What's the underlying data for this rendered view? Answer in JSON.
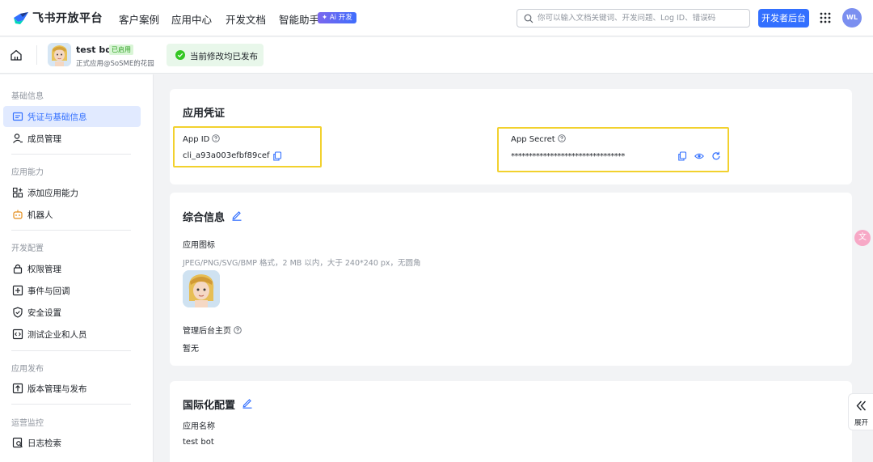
{
  "nav": {
    "brand": "飞书开放平台",
    "links": [
      "客户案例",
      "应用中心",
      "开发文档",
      "智能助手"
    ],
    "ai_badge": "✦ Ai 开发",
    "search_placeholder": "你可以输入文档关键词、开发问题、Log ID、错误码",
    "dev_button": "开发者后台",
    "avatar_initials": "WL"
  },
  "subheader": {
    "app_name": "test bot",
    "app_status_tag": "已启用",
    "app_subtitle": "正式应用@SoSME的花园",
    "status_message": "当前修改均已发布"
  },
  "sidebar": {
    "sections": [
      {
        "title": "基础信息",
        "items": [
          {
            "label": "凭证与基础信息",
            "icon": "credential-icon",
            "active": true
          },
          {
            "label": "成员管理",
            "icon": "member-icon",
            "active": false
          }
        ]
      },
      {
        "title": "应用能力",
        "items": [
          {
            "label": "添加应用能力",
            "icon": "add-capability-icon",
            "active": false
          },
          {
            "label": "机器人",
            "icon": "robot-icon",
            "active": false
          }
        ]
      },
      {
        "title": "开发配置",
        "items": [
          {
            "label": "权限管理",
            "icon": "lock-icon",
            "active": false
          },
          {
            "label": "事件与回调",
            "icon": "event-icon",
            "active": false
          },
          {
            "label": "安全设置",
            "icon": "shield-icon",
            "active": false
          },
          {
            "label": "测试企业和人员",
            "icon": "code-icon",
            "active": false
          }
        ]
      },
      {
        "title": "应用发布",
        "items": [
          {
            "label": "版本管理与发布",
            "icon": "upload-icon",
            "active": false
          }
        ]
      },
      {
        "title": "运营监控",
        "items": [
          {
            "label": "日志检索",
            "icon": "log-search-icon",
            "active": false
          }
        ]
      }
    ]
  },
  "credentials": {
    "title": "应用凭证",
    "app_id_label": "App ID",
    "app_id_value": "cli_a93a003efbf89cef",
    "app_secret_label": "App Secret",
    "app_secret_value": "********************************"
  },
  "general": {
    "title": "综合信息",
    "icon_label": "应用图标",
    "icon_hint": "JPEG/PNG/SVG/BMP 格式，2 MB 以内，大于 240*240 px，无圆角",
    "homepage_label": "管理后台主页",
    "homepage_value": "暂无"
  },
  "i18n": {
    "title": "国际化配置",
    "name_label": "应用名称",
    "name_value": "test bot"
  },
  "floaters": {
    "translate_glyph": "文",
    "expand_label": "展开"
  },
  "colors": {
    "primary": "#3370ff",
    "highlight": "#f2d12e",
    "success": "#2ea121"
  }
}
